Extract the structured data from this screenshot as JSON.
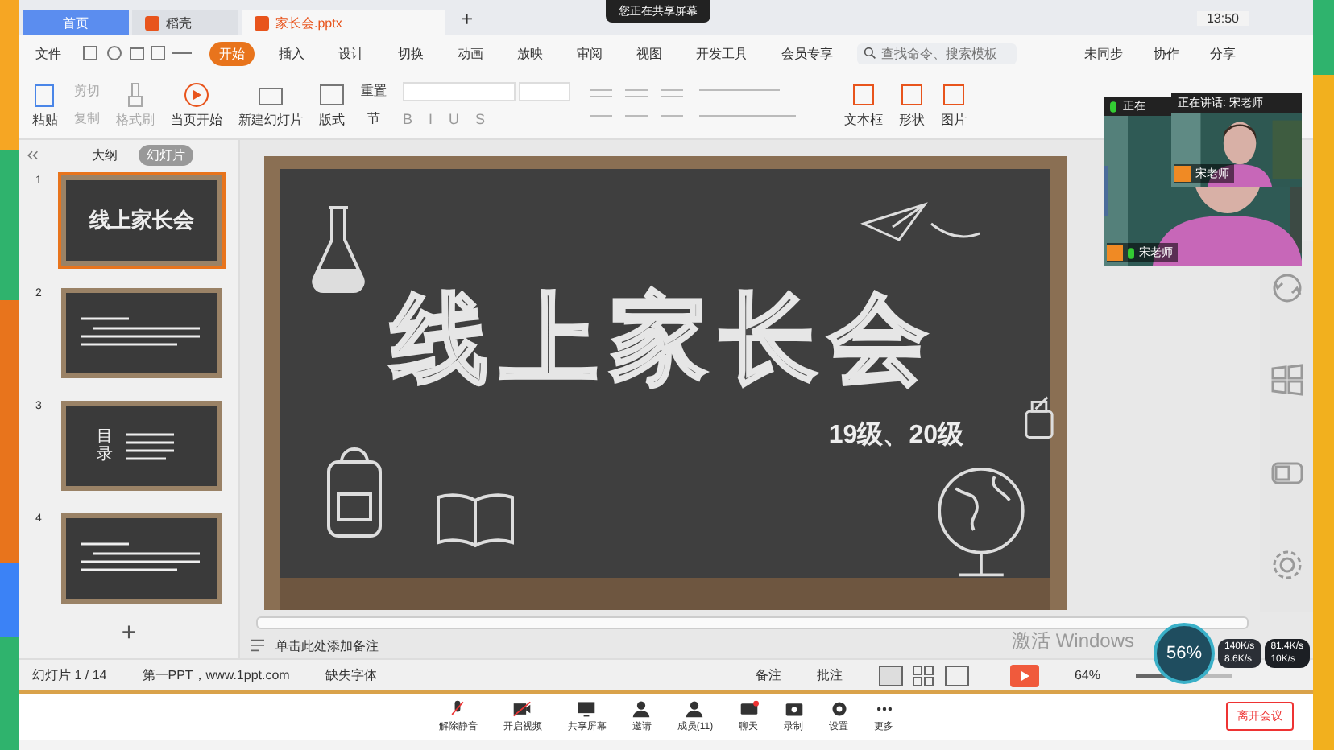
{
  "top_bar": {
    "sharing_notice": "您正在共享屏幕",
    "time": "13:50"
  },
  "tabs": [
    {
      "label": "首页",
      "kind": "home",
      "selected": false
    },
    {
      "label": "稻壳",
      "kind": "docer",
      "selected": false
    },
    {
      "label": "家长会.pptx",
      "kind": "file",
      "selected": true
    }
  ],
  "new_tab": "+",
  "menu": {
    "file": "文件",
    "tabs": [
      {
        "label": "开始",
        "selected": true
      },
      {
        "label": "插入",
        "selected": false
      },
      {
        "label": "设计",
        "selected": false
      },
      {
        "label": "切换",
        "selected": false
      },
      {
        "label": "动画",
        "selected": false
      },
      {
        "label": "放映",
        "selected": false
      },
      {
        "label": "审阅",
        "selected": false
      },
      {
        "label": "视图",
        "selected": false
      },
      {
        "label": "开发工具",
        "selected": false
      },
      {
        "label": "会员专享",
        "selected": false
      }
    ],
    "search": {
      "placeholder": "查找命令、搜索模板"
    },
    "actions": [
      "未同步",
      "协作",
      "分享"
    ]
  },
  "ribbon": {
    "paste": "粘贴",
    "small": [
      {
        "label": "剪切",
        "disabled": true
      },
      {
        "label": "复制",
        "disabled": true
      }
    ],
    "format_painter": {
      "label": "格式刷",
      "disabled": true
    },
    "play": "当页开始",
    "new_slide": "新建幻灯片",
    "layout": "版式",
    "reset": "重置",
    "section": "节",
    "format_buttons": [
      "B",
      "I",
      "U",
      "S"
    ],
    "insert": [
      "文本框",
      "形状",
      "图片"
    ]
  },
  "panel": {
    "view_tabs": [
      {
        "label": "大纲",
        "selected": false
      },
      {
        "label": "幻灯片",
        "selected": true
      }
    ],
    "slides": [
      {
        "number": "1",
        "selected": true,
        "title": "线上家长会"
      },
      {
        "number": "2",
        "selected": false
      },
      {
        "number": "3",
        "selected": false,
        "title": "目录"
      },
      {
        "number": "4",
        "selected": false
      }
    ],
    "add": "+"
  },
  "slide": {
    "title": "线上家长会",
    "subtitle": "19级、20级"
  },
  "notes": {
    "placeholder": "单击此处添加备注"
  },
  "status_bar": {
    "slide_count": "幻灯片 1 / 14",
    "theme": "第一PPT，www.1ppt.com",
    "missing_fonts": "缺失字体",
    "notes": "备注",
    "comments": "批注",
    "zoom": "64%",
    "zoom_level": {
      "level": 0.5
    }
  },
  "meeting_bar": {
    "buttons": [
      {
        "label": "解除静音",
        "kind": "mic"
      },
      {
        "label": "开启视频",
        "kind": "video"
      },
      {
        "label": "共享屏幕",
        "kind": "screen"
      },
      {
        "label": "邀请",
        "kind": "invite"
      },
      {
        "label": "成员(11)",
        "kind": "members"
      },
      {
        "label": "聊天",
        "kind": "chat"
      },
      {
        "label": "录制",
        "kind": "record"
      },
      {
        "label": "设置",
        "kind": "settings"
      },
      {
        "label": "更多",
        "kind": "more"
      }
    ],
    "leave": "离开会议"
  },
  "video": {
    "back_header": "正在",
    "front_header": "正在讲话: 宋老师",
    "tiles": [
      {
        "name": "宋老师"
      },
      {
        "name": "宋老师"
      }
    ]
  },
  "network": {
    "cpu": "56%",
    "upload": "81.4K/s",
    "upload_peak": "10K/s",
    "download": "140K/s",
    "download_other": "8.6K/s"
  },
  "windows_notice": "激活 Windows"
}
